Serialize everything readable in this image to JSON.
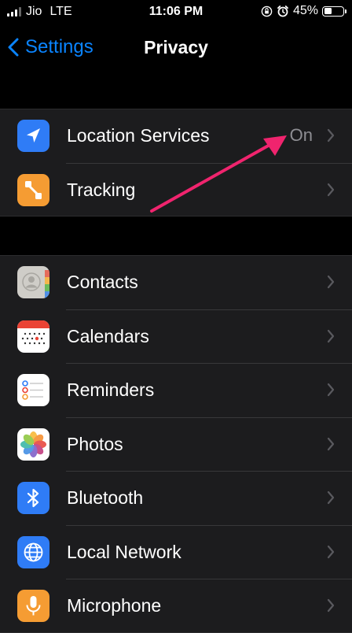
{
  "status_bar": {
    "carrier": "Jio",
    "network": "LTE",
    "time": "11:06 PM",
    "battery": "45%",
    "battery_level": 0.45
  },
  "nav": {
    "back_label": "Settings",
    "title": "Privacy"
  },
  "group1": [
    {
      "label": "Location Services",
      "value": "On",
      "icon": "location-arrow-icon",
      "color": "#2f7cf6"
    },
    {
      "label": "Tracking",
      "icon": "tracking-icon",
      "color": "#f59c33"
    }
  ],
  "group2": [
    {
      "label": "Contacts",
      "icon": "contacts-icon",
      "color": "#cfcdc8"
    },
    {
      "label": "Calendars",
      "icon": "calendar-icon",
      "color": "#ffffff"
    },
    {
      "label": "Reminders",
      "icon": "reminders-icon",
      "color": "#ffffff"
    },
    {
      "label": "Photos",
      "icon": "photos-icon",
      "color": "#ffffff"
    },
    {
      "label": "Bluetooth",
      "icon": "bluetooth-icon",
      "color": "#2f7cf6"
    },
    {
      "label": "Local Network",
      "icon": "globe-icon",
      "color": "#2f7cf6"
    },
    {
      "label": "Microphone",
      "icon": "microphone-icon",
      "color": "#f59c33"
    }
  ],
  "annotation": {
    "color": "#f0246e"
  }
}
